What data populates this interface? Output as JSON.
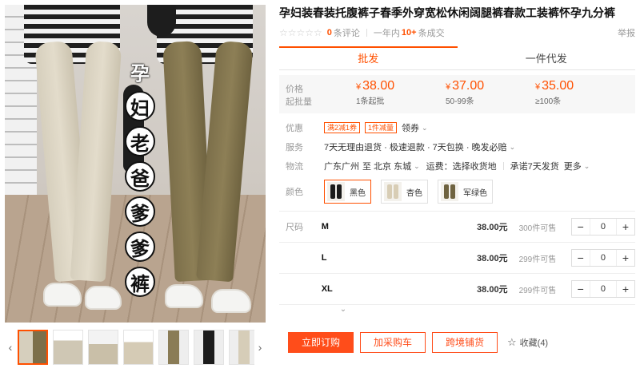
{
  "gallery": {
    "overlay_chars": [
      "孕",
      "妇",
      "老",
      "爸",
      "爹",
      "爹",
      "裤"
    ],
    "thumb_prev": "‹",
    "thumb_next": "›",
    "thumb_count": 7,
    "active_thumb": 0
  },
  "product": {
    "title": "孕妇装春装托腹裤子春季外穿宽松休闲阔腿裤春款工装裤怀孕九分裤",
    "rating_count": "0",
    "rating_text": "条评论",
    "sold_prefix": "一年内",
    "sold_num": "10+",
    "sold_suffix": "条成交",
    "report": "举报"
  },
  "tabs": [
    {
      "label": "批发",
      "active": true
    },
    {
      "label": "一件代发",
      "active": false
    }
  ],
  "price": {
    "label_price": "价格",
    "label_qty": "起批量",
    "currency": "¥",
    "tiers": [
      {
        "value": "38.00",
        "qty": "1条起批"
      },
      {
        "value": "37.00",
        "qty": "50-99条"
      },
      {
        "value": "35.00",
        "qty": "≥100条"
      }
    ]
  },
  "promo_row": {
    "label": "优惠",
    "tags": [
      "满2减1券",
      "1件减量"
    ],
    "more": "领券"
  },
  "service_row": {
    "label": "服务",
    "text": "7天无理由退货 · 极速退款 · 7天包换 · 晚发必赔"
  },
  "logistics_row": {
    "label": "物流",
    "from": "广东广州",
    "to": "至 北京 东城",
    "fee": "运费：选择收货地",
    "delivery": "承诺7天发货",
    "more": "更多"
  },
  "color_row": {
    "label": "颜色",
    "options": [
      {
        "name": "黑色",
        "selected": true,
        "leg": "#1b1b1b"
      },
      {
        "name": "杏色",
        "selected": false,
        "leg": "#d8cdb5"
      },
      {
        "name": "军绿色",
        "selected": false,
        "leg": "#6f6340"
      }
    ]
  },
  "size_table": {
    "label": "尺码",
    "rows": [
      {
        "size": "M",
        "price": "38.00元",
        "stock": "300件可售",
        "qty": "0"
      },
      {
        "size": "L",
        "price": "38.00元",
        "stock": "299件可售",
        "qty": "0"
      },
      {
        "size": "XL",
        "price": "38.00元",
        "stock": "299件可售",
        "qty": "0"
      }
    ],
    "minus": "−",
    "plus": "+"
  },
  "actions": {
    "order": "立即订购",
    "cart": "加采购车",
    "cross": "跨境铺货",
    "fav": "收藏(4)"
  },
  "colors": {
    "accent": "#ff5000"
  }
}
